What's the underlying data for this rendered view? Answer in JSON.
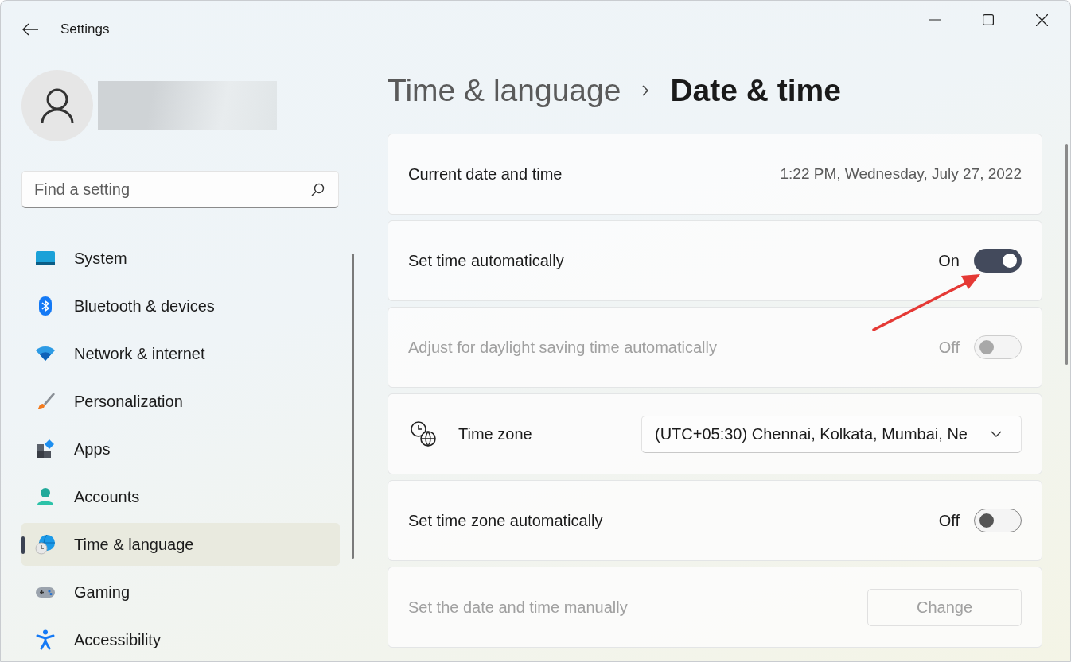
{
  "window": {
    "title": "Settings"
  },
  "search": {
    "placeholder": "Find a setting"
  },
  "nav": [
    {
      "label": "System",
      "selected": false
    },
    {
      "label": "Bluetooth & devices",
      "selected": false
    },
    {
      "label": "Network & internet",
      "selected": false
    },
    {
      "label": "Personalization",
      "selected": false
    },
    {
      "label": "Apps",
      "selected": false
    },
    {
      "label": "Accounts",
      "selected": false
    },
    {
      "label": "Time & language",
      "selected": true
    },
    {
      "label": "Gaming",
      "selected": false
    },
    {
      "label": "Accessibility",
      "selected": false
    }
  ],
  "breadcrumb": {
    "parent": "Time & language",
    "current": "Date & time"
  },
  "settings": [
    {
      "kind": "info",
      "label": "Current date and time",
      "value": "1:22 PM, Wednesday, July 27, 2022"
    },
    {
      "kind": "toggle",
      "label": "Set time automatically",
      "state": "On",
      "on": true,
      "disabled": false
    },
    {
      "kind": "toggle",
      "label": "Adjust for daylight saving time automatically",
      "state": "Off",
      "on": false,
      "disabled": true
    },
    {
      "kind": "dropdown",
      "label": "Time zone",
      "value": "(UTC+05:30) Chennai, Kolkata, Mumbai, Ne"
    },
    {
      "kind": "toggle",
      "label": "Set time zone automatically",
      "state": "Off",
      "on": false,
      "disabled": false
    },
    {
      "kind": "button",
      "label": "Set the date and time manually",
      "button": "Change",
      "disabled": true
    }
  ]
}
